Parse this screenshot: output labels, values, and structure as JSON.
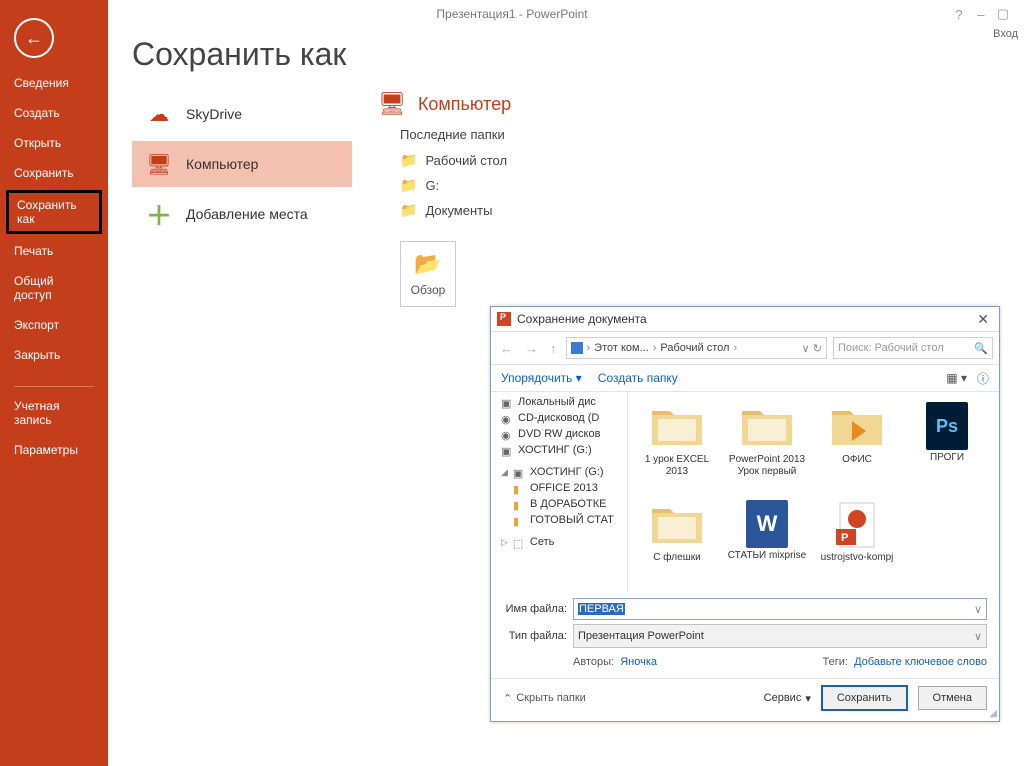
{
  "titlebar": {
    "center": "Презентация1 - PowerPoint",
    "login": "Вход",
    "help": "?"
  },
  "sidebar": {
    "items": [
      {
        "label": "Сведения"
      },
      {
        "label": "Создать"
      },
      {
        "label": "Открыть"
      },
      {
        "label": "Сохранить"
      },
      {
        "label": "Сохранить как"
      },
      {
        "label": "Печать"
      },
      {
        "label": "Общий доступ"
      },
      {
        "label": "Экспорт"
      },
      {
        "label": "Закрыть"
      },
      {
        "label": "Учетная запись"
      },
      {
        "label": "Параметры"
      }
    ]
  },
  "page": {
    "title": "Сохранить как"
  },
  "places": [
    {
      "label": "SkyDrive"
    },
    {
      "label": "Компьютер"
    },
    {
      "label": "Добавление места"
    }
  ],
  "detail": {
    "head": "Компьютер",
    "recent_label": "Последние папки",
    "recent": [
      {
        "label": "Рабочий стол"
      },
      {
        "label": "G:"
      },
      {
        "label": "Документы"
      }
    ],
    "browse": "Обзор"
  },
  "dialog": {
    "title": "Сохранение документа",
    "path": [
      "Этот ком...",
      "Рабочий стол"
    ],
    "search_placeholder": "Поиск: Рабочий стол",
    "organize": "Упорядочить",
    "newfolder": "Создать папку",
    "tree": [
      {
        "label": "Локальный дис",
        "type": "drive"
      },
      {
        "label": "CD-дисковод (D",
        "type": "drive"
      },
      {
        "label": "DVD RW дисков",
        "type": "drive"
      },
      {
        "label": "ХОСТИНГ (G:)",
        "type": "drive"
      },
      {
        "label": "ХОСТИНГ (G:)",
        "type": "drive-open"
      },
      {
        "label": "OFFICE 2013",
        "type": "folder"
      },
      {
        "label": "В ДОРАБОТКЕ",
        "type": "folder"
      },
      {
        "label": "ГОТОВЫЙ СТАТ",
        "type": "folder"
      },
      {
        "label": "Сеть",
        "type": "net"
      }
    ],
    "files": [
      {
        "name": "1 урок EXCEL 2013",
        "type": "folder"
      },
      {
        "name": "PowerPoint 2013 Урок первый",
        "type": "folder"
      },
      {
        "name": "ОФИС",
        "type": "ofis"
      },
      {
        "name": "ПРОГИ",
        "type": "ps"
      },
      {
        "name": "С флешки",
        "type": "folder"
      },
      {
        "name": "СТАТЬИ mixprise",
        "type": "word"
      },
      {
        "name": "ustrojstvo-kompj",
        "type": "ppt"
      }
    ],
    "filename_label": "Имя файла:",
    "filename_value": "ПЕРВАЯ",
    "filetype_label": "Тип файла:",
    "filetype_value": "Презентация PowerPoint",
    "authors_label": "Авторы:",
    "authors_value": "Яночка",
    "tags_label": "Теги:",
    "tags_value": "Добавьте ключевое слово",
    "hide": "Скрыть папки",
    "service": "Сервис",
    "save": "Сохранить",
    "cancel": "Отмена"
  }
}
